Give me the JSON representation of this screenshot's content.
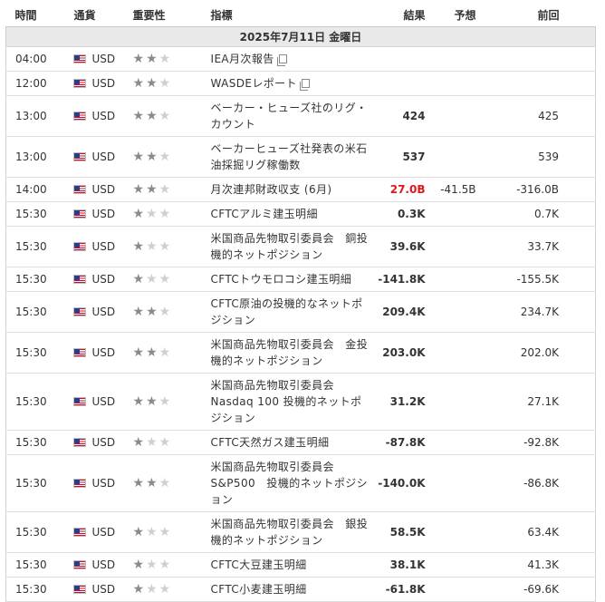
{
  "header": {
    "time": "時間",
    "currency": "通貨",
    "importance": "重要性",
    "event": "指標",
    "actual": "結果",
    "forecast": "予想",
    "previous": "前回"
  },
  "date_label": "2025年7月11日 金曜日",
  "colors": {
    "actual_negative": "#e0161c",
    "star_on": "#8a8a8a",
    "star_off": "#cfcfcf"
  },
  "events": [
    {
      "time": "04:00",
      "currency": "USD",
      "stars": 2,
      "event": "IEA月次報告",
      "has_doc_icon": true,
      "actual": "",
      "forecast": "",
      "previous": ""
    },
    {
      "time": "12:00",
      "currency": "USD",
      "stars": 2,
      "event": "WASDEレポート",
      "has_doc_icon": true,
      "actual": "",
      "forecast": "",
      "previous": ""
    },
    {
      "time": "13:00",
      "currency": "USD",
      "stars": 2,
      "event": "ベーカー・ヒューズ社のリグ・カウント",
      "actual": "424",
      "forecast": "",
      "previous": "425"
    },
    {
      "time": "13:00",
      "currency": "USD",
      "stars": 2,
      "event": "ベーカーヒューズ社発表の米石油採掘リグ稼働数",
      "actual": "537",
      "forecast": "",
      "previous": "539"
    },
    {
      "time": "14:00",
      "currency": "USD",
      "stars": 2,
      "event": "月次連邦財政収支 (6月)",
      "actual": "27.0B",
      "actual_red": true,
      "forecast": "-41.5B",
      "previous": "-316.0B"
    },
    {
      "time": "15:30",
      "currency": "USD",
      "stars": 1,
      "event": "CFTCアルミ建玉明細",
      "actual": "0.3K",
      "forecast": "",
      "previous": "0.7K"
    },
    {
      "time": "15:30",
      "currency": "USD",
      "stars": 1,
      "event": "米国商品先物取引委員会　銅投機的ネットポジション",
      "actual": "39.6K",
      "forecast": "",
      "previous": "33.7K"
    },
    {
      "time": "15:30",
      "currency": "USD",
      "stars": 1,
      "event": "CFTCトウモロコシ建玉明細",
      "actual": "-141.8K",
      "forecast": "",
      "previous": "-155.5K"
    },
    {
      "time": "15:30",
      "currency": "USD",
      "stars": 2,
      "event": "CFTC原油の投機的なネットポジション",
      "actual": "209.4K",
      "forecast": "",
      "previous": "234.7K"
    },
    {
      "time": "15:30",
      "currency": "USD",
      "stars": 2,
      "event": "米国商品先物取引委員会　金投機的ネットポジション",
      "actual": "203.0K",
      "forecast": "",
      "previous": "202.0K"
    },
    {
      "time": "15:30",
      "currency": "USD",
      "stars": 2,
      "event": "米国商品先物取引委員会 Nasdaq 100 投機的ネットポジション",
      "actual": "31.2K",
      "forecast": "",
      "previous": "27.1K"
    },
    {
      "time": "15:30",
      "currency": "USD",
      "stars": 1,
      "event": "CFTC天然ガス建玉明細",
      "actual": "-87.8K",
      "forecast": "",
      "previous": "-92.8K"
    },
    {
      "time": "15:30",
      "currency": "USD",
      "stars": 2,
      "event": "米国商品先物取引委員会 S&P500　投機的ネットポジション",
      "actual": "-140.0K",
      "forecast": "",
      "previous": "-86.8K"
    },
    {
      "time": "15:30",
      "currency": "USD",
      "stars": 1,
      "event": "米国商品先物取引委員会　銀投機的ネットポジション",
      "actual": "58.5K",
      "forecast": "",
      "previous": "63.4K"
    },
    {
      "time": "15:30",
      "currency": "USD",
      "stars": 1,
      "event": "CFTC大豆建玉明細",
      "actual": "38.1K",
      "forecast": "",
      "previous": "41.3K"
    },
    {
      "time": "15:30",
      "currency": "USD",
      "stars": 1,
      "event": "CFTC小麦建玉明細",
      "actual": "-61.8K",
      "forecast": "",
      "previous": "-69.6K"
    }
  ]
}
